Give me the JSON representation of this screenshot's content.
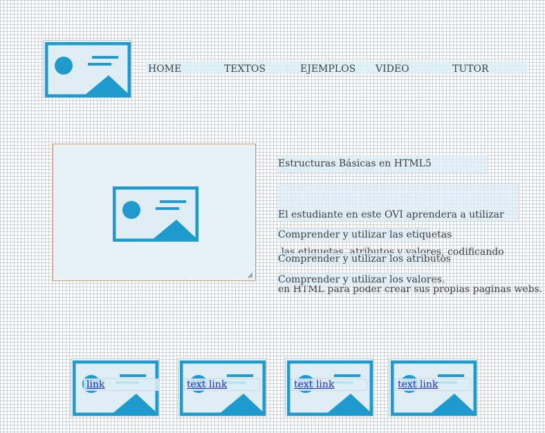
{
  "nav": {
    "items": [
      "HOME",
      "TEXTOS",
      "EJEMPLOS",
      "VIDEO",
      "TUTOR"
    ]
  },
  "content": {
    "heading": "Estructuras Básicas en HTML5",
    "description_lines": [
      "El estudiante en este OVI aprendera a utilizar",
      " las etiquetas, atributos y valores, codificando",
      "en HTML para poder crear sus propias paginas webs."
    ],
    "objectives": [
      "Comprender y utilizar las etiquetas",
      "Comprender y utilizar los atributos",
      "Comprender y utilizar los valores."
    ]
  },
  "thumbnails": [
    {
      "link": "link"
    },
    {
      "link": "text link"
    },
    {
      "link": "text link"
    },
    {
      "link": "text link"
    }
  ],
  "colors": {
    "icon_blue": "#1e9bcc",
    "placeholder_bg": "#e6f2f8",
    "link": "#1d27d6"
  },
  "icons": {
    "placeholder": "image-placeholder-icon"
  }
}
